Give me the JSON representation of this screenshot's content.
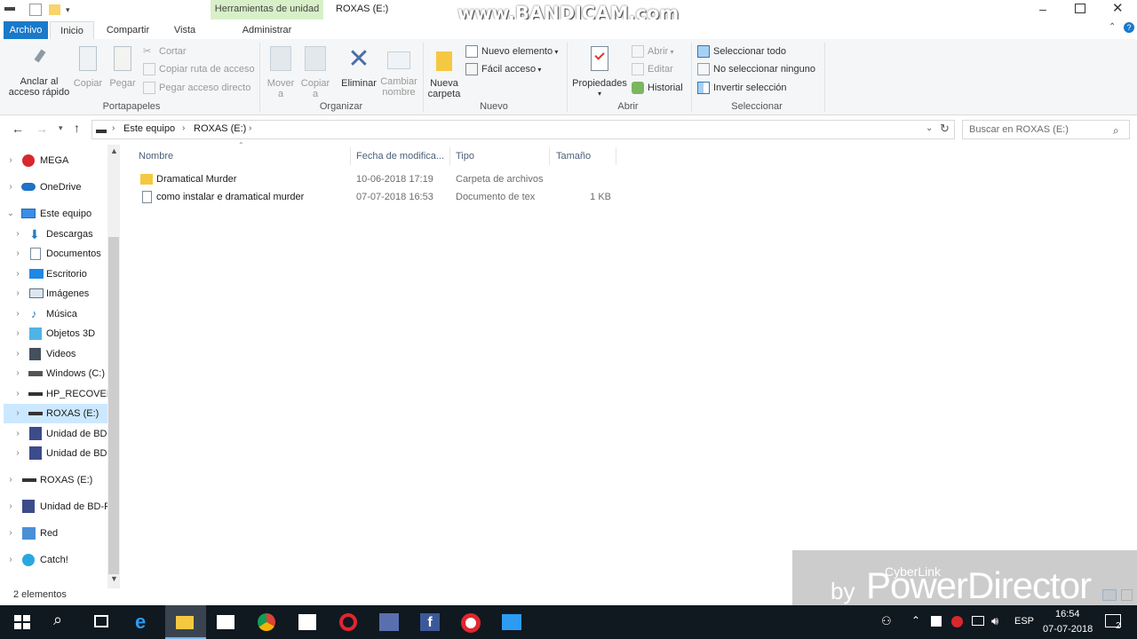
{
  "window": {
    "title": "ROXAS (E:)",
    "context_tab_header": "Herramientas de unidad",
    "controls": [
      "minimize",
      "maximize",
      "close"
    ]
  },
  "watermark": "www.BANDICAM.com",
  "ribbon_tabs": [
    {
      "label": "Archivo"
    },
    {
      "label": "Inicio"
    },
    {
      "label": "Compartir"
    },
    {
      "label": "Vista"
    },
    {
      "label": "Administrar"
    }
  ],
  "ribbon": {
    "portapapeles": {
      "label": "Portapapeles",
      "anclar": "Anclar al\nacceso rápido",
      "copiar": "Copiar",
      "pegar": "Pegar",
      "cortar": "Cortar",
      "copiar_ruta": "Copiar ruta de acceso",
      "pegar_acceso": "Pegar acceso directo"
    },
    "organizar": {
      "label": "Organizar",
      "mover": "Mover",
      "mover2": "a",
      "copiar": "Copiar",
      "copiar2": "a",
      "eliminar": "Eliminar",
      "cambiar": "Cambiar",
      "cambiar2": "nombre"
    },
    "nuevo": {
      "label": "Nuevo",
      "nueva": "Nueva",
      "carpeta": "carpeta",
      "nuevo_elemento": "Nuevo elemento",
      "facil_acceso": "Fácil acceso"
    },
    "abrir": {
      "label": "Abrir",
      "propiedades": "Propiedades",
      "abrir": "Abrir",
      "editar": "Editar",
      "historial": "Historial"
    },
    "seleccionar": {
      "label": "Seleccionar",
      "todo": "Seleccionar todo",
      "ninguno": "No seleccionar ninguno",
      "invertir": "Invertir selección"
    }
  },
  "address": {
    "crumbs": [
      "Este equipo",
      "ROXAS (E:)"
    ],
    "search_placeholder": "Buscar en ROXAS (E:)"
  },
  "nav": [
    {
      "label": "MEGA"
    },
    {
      "label": "OneDrive"
    },
    {
      "label": "Este equipo"
    },
    {
      "label": "Descargas"
    },
    {
      "label": "Documentos"
    },
    {
      "label": "Escritorio"
    },
    {
      "label": "Imágenes"
    },
    {
      "label": "Música"
    },
    {
      "label": "Objetos 3D"
    },
    {
      "label": "Videos"
    },
    {
      "label": "Windows (C:)"
    },
    {
      "label": "HP_RECOVERY"
    },
    {
      "label": "ROXAS (E:)"
    },
    {
      "label": "Unidad de BD"
    },
    {
      "label": "Unidad de BD"
    },
    {
      "label": "ROXAS (E:)"
    },
    {
      "label": "Unidad de BD-R"
    },
    {
      "label": "Red"
    },
    {
      "label": "Catch!"
    }
  ],
  "columns": [
    "Nombre",
    "Fecha de modifica...",
    "Tipo",
    "Tamaño"
  ],
  "files": [
    {
      "name": "Dramatical Murder",
      "date": "10-06-2018 17:19",
      "type": "Carpeta de archivos",
      "size": ""
    },
    {
      "name": "como instalar e dramatical murder",
      "date": "07-07-2018 16:53",
      "type": "Documento de tex",
      "size": "1 KB"
    }
  ],
  "status": "2 elementos",
  "taskbar": {
    "lang": "ESP",
    "time": "16:54",
    "date": "07-07-2018",
    "notif_count": "2"
  },
  "powerdirector": {
    "brand": "CyberLink",
    "by": "by",
    "product": "PowerDirector"
  },
  "colors": {
    "accent": "#1979ca",
    "selection": "#cce8ff",
    "taskbar": "#101820",
    "context_tab": "#d8f0c8"
  }
}
